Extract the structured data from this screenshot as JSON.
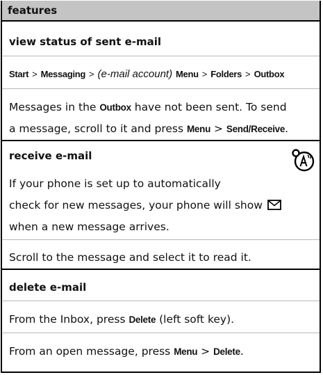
{
  "header": {
    "title": "features"
  },
  "sections": [
    {
      "heading": "view status of sent e-mail",
      "path": {
        "start": "Start",
        "messaging": "Messaging",
        "account": "(e-mail account)",
        "menu": "Menu",
        "folders": "Folders",
        "outbox": "Outbox",
        "sep": ">"
      },
      "para1": {
        "a": "Messages in the ",
        "outbox": "Outbox",
        "b": " have not been sent. To send",
        "c": "a message, scroll to it and press ",
        "menu": "Menu",
        "sep": " > ",
        "send": "Send/Receive",
        "end": "."
      }
    },
    {
      "heading": "receive e-mail",
      "icon": "network-feature-icon",
      "line1": "If your phone is set up to automatically",
      "line2": "check for new messages, your phone will show",
      "inline_icon": "envelope-icon",
      "line3": "when a new message arrives.",
      "line4": "Scroll to the message and select it to read it."
    },
    {
      "heading": "delete e-mail",
      "line1": {
        "a": "From the Inbox, press ",
        "delete": "Delete",
        "b": " (left soft key)."
      },
      "line2": {
        "a": "From an open message, press ",
        "menu": "Menu",
        "sep": " > ",
        "delete": "Delete",
        "end": "."
      }
    }
  ]
}
